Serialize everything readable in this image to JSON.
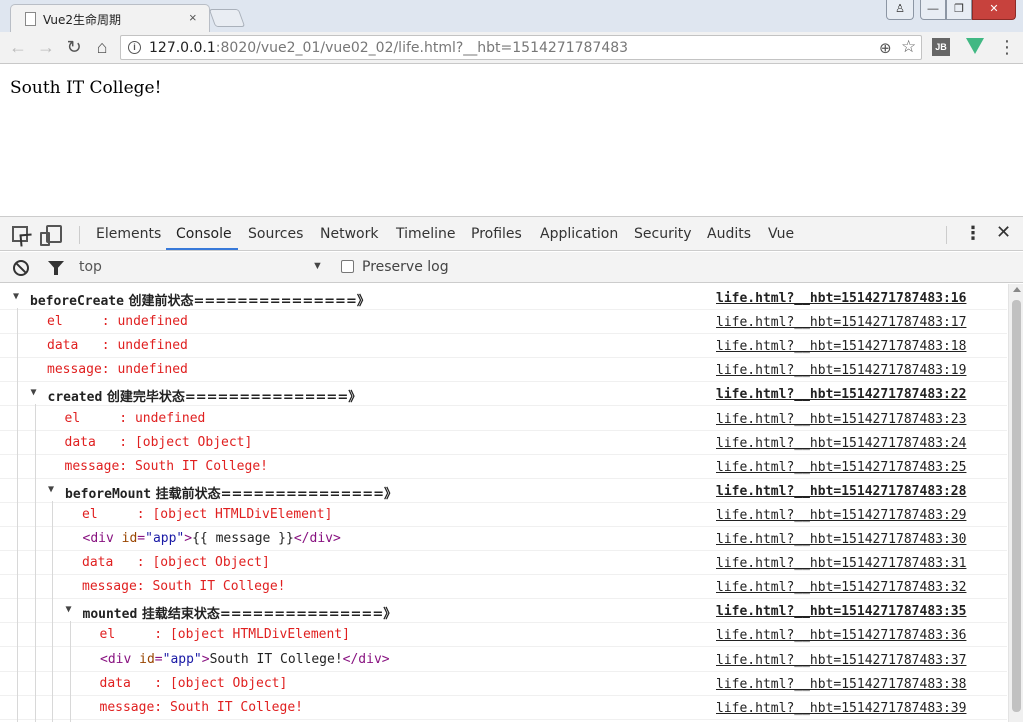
{
  "browser": {
    "tab_title": "Vue2生命周期",
    "tab_close": "×",
    "url_host": "127.0.0.1",
    "url_rest": ":8020/vue2_01/vue02_02/life.html?__hbt=1514271787483",
    "window_user": "♙",
    "window_min": "—",
    "window_max": "❐",
    "window_close": "✕",
    "ext_jb": "JB"
  },
  "page": {
    "text": "South IT College!"
  },
  "devtools": {
    "tabs": [
      "Elements",
      "Console",
      "Sources",
      "Network",
      "Timeline",
      "Profiles",
      "Application",
      "Security",
      "Audits",
      "Vue"
    ],
    "active_tab": "Console",
    "context": "top",
    "preserve_log_label": "Preserve log",
    "preserve_log_checked": false,
    "close": "✕"
  },
  "console": {
    "rows": [
      {
        "type": "group",
        "label": "beforeCreate",
        "cn": " 创建前状态===============》",
        "src": "life.html?__hbt=1514271787483:16"
      },
      {
        "type": "log",
        "text": "el     : undefined",
        "src": "life.html?__hbt=1514271787483:17"
      },
      {
        "type": "log",
        "text": "data   : undefined",
        "src": "life.html?__hbt=1514271787483:18"
      },
      {
        "type": "log",
        "text": "message: undefined",
        "src": "life.html?__hbt=1514271787483:19"
      },
      {
        "type": "group",
        "label": "created",
        "cn": " 创建完毕状态===============》",
        "src": "life.html?__hbt=1514271787483:22"
      },
      {
        "type": "log",
        "text": "el     : undefined",
        "src": "life.html?__hbt=1514271787483:23"
      },
      {
        "type": "log",
        "text": "data   : [object Object]",
        "src": "life.html?__hbt=1514271787483:24"
      },
      {
        "type": "log",
        "text": "message: South IT College!",
        "src": "life.html?__hbt=1514271787483:25"
      },
      {
        "type": "group",
        "label": "beforeMount",
        "cn": " 挂载前状态===============》",
        "src": "life.html?__hbt=1514271787483:28"
      },
      {
        "type": "log",
        "text": "el     : [object HTMLDivElement]",
        "src": "life.html?__hbt=1514271787483:29"
      },
      {
        "type": "html",
        "attr_name": "id",
        "attr_val": "\"app\"",
        "inner": "{{ message }}",
        "src": "life.html?__hbt=1514271787483:30"
      },
      {
        "type": "log",
        "text": "data   : [object Object]",
        "src": "life.html?__hbt=1514271787483:31"
      },
      {
        "type": "log",
        "text": "message: South IT College!",
        "src": "life.html?__hbt=1514271787483:32"
      },
      {
        "type": "group",
        "label": "mounted",
        "cn": " 挂载结束状态===============》",
        "src": "life.html?__hbt=1514271787483:35"
      },
      {
        "type": "log",
        "text": "el     : [object HTMLDivElement]",
        "src": "life.html?__hbt=1514271787483:36"
      },
      {
        "type": "html",
        "attr_name": "id",
        "attr_val": "\"app\"",
        "inner": "South IT College!",
        "src": "life.html?__hbt=1514271787483:37"
      },
      {
        "type": "log",
        "text": "data   : [object Object]",
        "src": "life.html?__hbt=1514271787483:38"
      },
      {
        "type": "log",
        "text": "message: South IT College!",
        "src": "life.html?__hbt=1514271787483:39"
      }
    ]
  },
  "colors": {
    "log_red": "#e02020",
    "tab_accent": "#3879d9",
    "vue_green": "#41b883",
    "close_red": "#c7423d"
  }
}
